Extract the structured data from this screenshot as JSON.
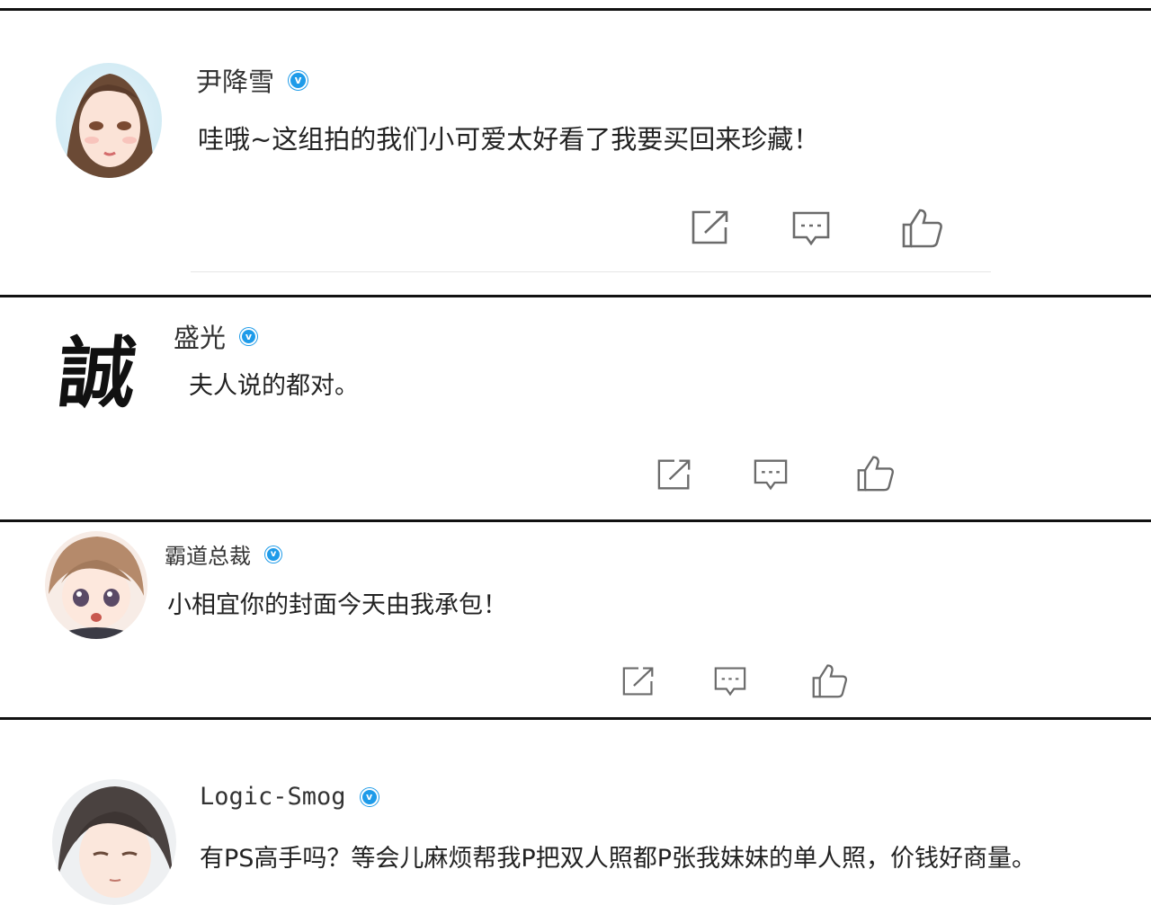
{
  "comments": [
    {
      "name": "尹降雪",
      "text": "哇哦~这组拍的我们小可爱太好看了我要买回来珍藏！"
    },
    {
      "name": "盛光",
      "text": "夫人说的都对。"
    },
    {
      "name": "霸道总裁",
      "text": "小相宜你的封面今天由我承包！"
    },
    {
      "name": "Logic-Smog",
      "text": "有PS高手吗？等会儿麻烦帮我P把双人照都P张我妹妹的单人照，价钱好商量。"
    }
  ],
  "logo_calligraphy": "誠",
  "colors": {
    "verified_badge": "#1e9be9",
    "icon_stroke": "#6b6b6b",
    "panel_border": "#111111"
  }
}
